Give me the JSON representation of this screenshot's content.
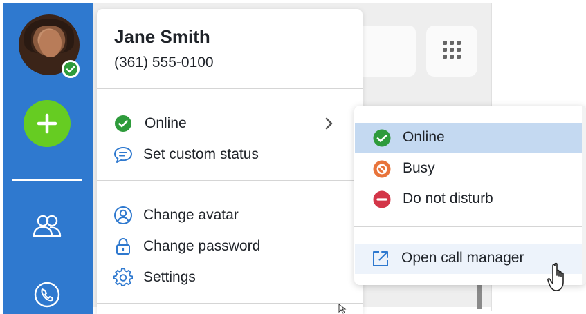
{
  "profile": {
    "name": "Jane Smith",
    "phone": "(361) 555-0100"
  },
  "status_menu": {
    "current_status_label": "Online",
    "set_custom_status_label": "Set custom status"
  },
  "account_menu": {
    "change_avatar_label": "Change avatar",
    "change_password_label": "Change password",
    "settings_label": "Settings"
  },
  "status_submenu": {
    "items": [
      {
        "label": "Online",
        "icon": "check-circle-icon",
        "color": "#2e9b3b",
        "selected": true
      },
      {
        "label": "Busy",
        "icon": "blocked-circle-icon",
        "color": "#e8743b",
        "selected": false
      },
      {
        "label": "Do not disturb",
        "icon": "minus-circle-icon",
        "color": "#d33548",
        "selected": false
      }
    ],
    "open_call_manager_label": "Open call manager"
  },
  "rail": {
    "items": [
      {
        "icon": "add-icon"
      },
      {
        "icon": "contacts-icon"
      },
      {
        "icon": "phone-icon"
      }
    ]
  },
  "colors": {
    "rail_blue": "#2f79cf",
    "add_green": "#66cc22",
    "online_green": "#2e9b3b",
    "busy_orange": "#e8743b",
    "dnd_red": "#d33548",
    "selected_row": "#c4d9f1",
    "icon_blue": "#2f79cf"
  }
}
